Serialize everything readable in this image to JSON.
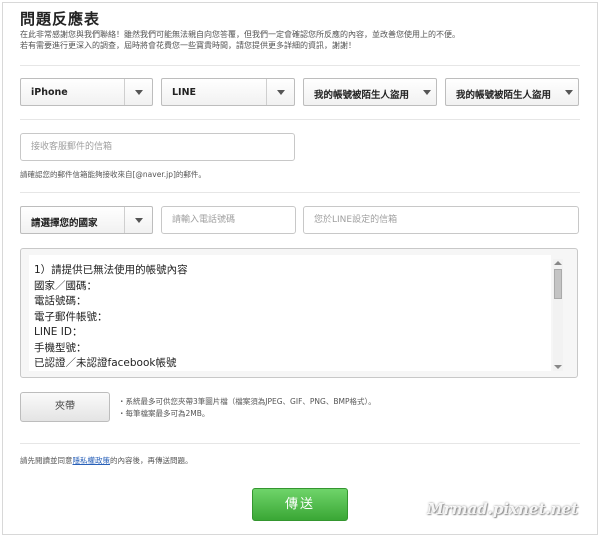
{
  "form": {
    "title": "問題反應表",
    "intro_line1": "在此非常感謝您與我們聯絡！雖然我們可能無法親自向您答覆，但我們一定會確認您所反應的內容，並改善您使用上的不便。",
    "intro_line2": "若有需要進行更深入的調查，屆時將會花費您一些寶貴時間，請您提供更多詳細的資訊，謝謝！"
  },
  "selectors": {
    "device": "iPhone",
    "app": "LINE",
    "category": "我的帳號被陌生人盜用",
    "subcategory": "我的帳號被陌生人盜用"
  },
  "email": {
    "placeholder": "接收客服郵件的信箱",
    "note": "請確認您的郵件信箱能夠接收來自[@naver.jp]的郵件。"
  },
  "contact": {
    "country": "請選擇您的國家",
    "phone_placeholder": "請輸入電話號碼",
    "line_email_placeholder": "您於LINE設定的信箱"
  },
  "details": {
    "lines": [
      "1）請提供已無法使用的帳號內容",
      "國家／國碼：",
      "電話號碼：",
      "電子郵件帳號：",
      "LINE ID：",
      "手機型號：",
      "已認證／未認證facebook帳號"
    ]
  },
  "attachment": {
    "button_label": "夾帶",
    "note1": "・系統最多可供您夾帶3筆圖片檔（檔案須為JPEG、GIF、PNG、BMP格式）。",
    "note2": "・每筆檔案最多可為2MB。"
  },
  "policy": {
    "prefix": "請先閱讀並同意",
    "link": "隱私權政策",
    "suffix": "的內容後，再傳送問題。"
  },
  "submit": {
    "label": "傳送"
  },
  "watermark": "Mrmad.pixnet.net"
}
